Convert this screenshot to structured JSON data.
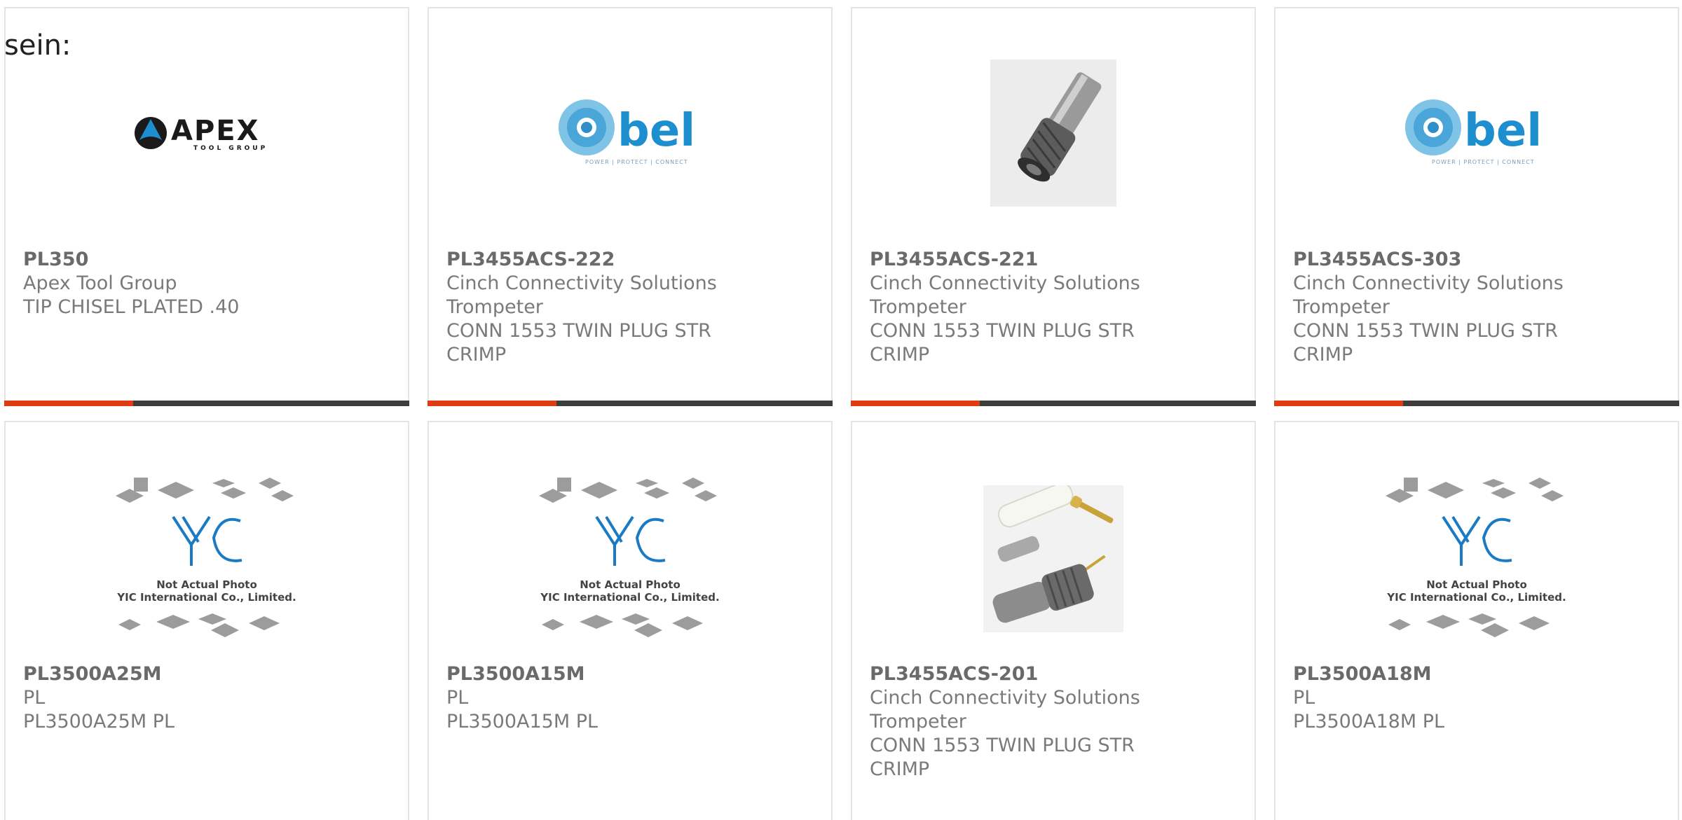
{
  "page": {
    "heading": "sein:"
  },
  "colors": {
    "accent": "#e03c12",
    "bar": "#3d3d3d",
    "border": "#e4e4e4",
    "bel_blue": "#1e8fce",
    "yic_blue": "#1a7bc4"
  },
  "products": [
    {
      "part": "PL350",
      "lines": [
        "Apex Tool Group",
        "TIP CHISEL PLATED .40"
      ],
      "image": "apex-logo"
    },
    {
      "part": "PL3455ACS-222",
      "lines": [
        "Cinch Connectivity Solutions",
        "Trompeter",
        "CONN 1553 TWIN PLUG STR",
        "CRIMP"
      ],
      "image": "bel-logo"
    },
    {
      "part": "PL3455ACS-221",
      "lines": [
        "Cinch Connectivity Solutions",
        "Trompeter",
        "CONN 1553 TWIN PLUG STR",
        "CRIMP"
      ],
      "image": "connector-photo"
    },
    {
      "part": "PL3455ACS-303",
      "lines": [
        "Cinch Connectivity Solutions",
        "Trompeter",
        "CONN 1553 TWIN PLUG STR",
        "CRIMP"
      ],
      "image": "bel-logo"
    },
    {
      "part": "PL3500A25M",
      "lines": [
        "PL",
        "PL3500A25M PL"
      ],
      "image": "yic-placeholder"
    },
    {
      "part": "PL3500A15M",
      "lines": [
        "PL",
        "PL3500A15M PL"
      ],
      "image": "yic-placeholder"
    },
    {
      "part": "PL3455ACS-201",
      "lines": [
        "Cinch Connectivity Solutions",
        "Trompeter",
        "CONN 1553 TWIN PLUG STR",
        "CRIMP"
      ],
      "image": "connector-kit-photo"
    },
    {
      "part": "PL3500A18M",
      "lines": [
        "PL",
        "PL3500A18M PL"
      ],
      "image": "yic-placeholder"
    }
  ],
  "logos": {
    "apex_text": "APEX",
    "apex_sub": "TOOL GROUP",
    "bel_text": "bel",
    "bel_tagline": "POWER | PROTECT | CONNECT",
    "yic_text": "YIC",
    "yic_note": "Not Actual Photo",
    "yic_company": "YIC International Co., Limited."
  }
}
